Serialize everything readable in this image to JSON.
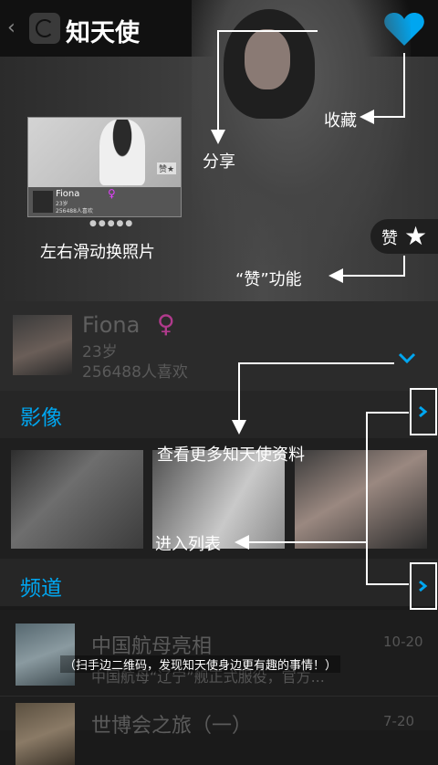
{
  "header": {
    "title": "知天使",
    "back_icon": "chevron-left-icon",
    "logo_icon": "app-logo-icon",
    "share_icon": "share-icon",
    "favorite_icon": "heart-icon"
  },
  "tutorial": {
    "swipe_tip": "左右滑动换照片",
    "share_tip": "分享",
    "favorite_tip": "收藏",
    "like_tip": "“赞”功能",
    "more_info_tip": "查看更多知天使资料",
    "list_tip": "进入列表",
    "scan_tip": "（扫手边二维码，发现知天使身边更有趣的事情！）",
    "preview": {
      "name": "Fiona",
      "gender": "♀",
      "age": "23岁",
      "likes": "256488人喜欢",
      "badge": "赞",
      "dots": "●●●●●"
    }
  },
  "like_button": {
    "label": "赞",
    "icon": "star-icon"
  },
  "profile": {
    "name": "Fiona",
    "gender": "♀",
    "age": "23岁",
    "likes": "256488人喜欢",
    "expand_icon": "chevron-down-icon"
  },
  "sections": {
    "photos": {
      "title": "影像",
      "arrow_icon": "chevron-right-icon"
    },
    "channels": {
      "title": "频道",
      "arrow_icon": "chevron-right-icon"
    }
  },
  "channels": [
    {
      "title": "中国航母亮相",
      "desc": "中国航母“辽宁”舰正式服役，官方...",
      "date": "10-20"
    },
    {
      "title": "世博会之旅（一）",
      "date": "7-20"
    }
  ],
  "colors": {
    "accent": "#00a6f0",
    "gender": "#b03a8c",
    "background": "#1a1a1a"
  }
}
